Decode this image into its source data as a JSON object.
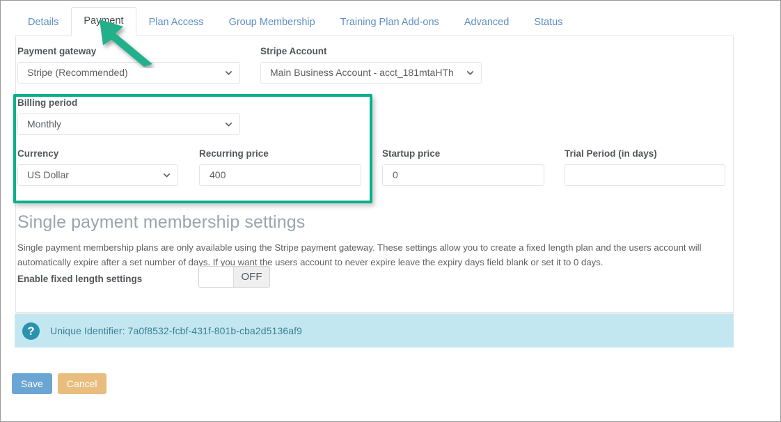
{
  "tabs": [
    {
      "label": "Details",
      "active": false
    },
    {
      "label": "Payment",
      "active": true
    },
    {
      "label": "Plan Access",
      "active": false
    },
    {
      "label": "Group Membership",
      "active": false
    },
    {
      "label": "Training Plan Add-ons",
      "active": false
    },
    {
      "label": "Advanced",
      "active": false
    },
    {
      "label": "Status",
      "active": false
    }
  ],
  "form": {
    "payment_gateway": {
      "label": "Payment gateway",
      "value": "Stripe (Recommended)"
    },
    "stripe_account": {
      "label": "Stripe Account",
      "value": "Main Business Account - acct_181mtaHTh"
    },
    "billing_period": {
      "label": "Billing period",
      "value": "Monthly"
    },
    "currency": {
      "label": "Currency",
      "value": "US Dollar"
    },
    "recurring_price": {
      "label": "Recurring price",
      "value": "400",
      "placeholder": ""
    },
    "startup_price": {
      "label": "Startup price",
      "value": "0",
      "placeholder": ""
    },
    "trial_period": {
      "label": "Trial Period (in days)",
      "value": "",
      "placeholder": ""
    }
  },
  "section": {
    "title": "Single payment membership settings",
    "description": "Single payment membership plans are only available using the Stripe payment gateway. These settings allow you to create a fixed length plan and the users account will automatically expire after a set number of days. If you want the users account to never expire leave the expiry days field blank or set it to 0 days.",
    "toggle": {
      "label": "Enable fixed length settings",
      "state": "OFF"
    }
  },
  "banner": {
    "icon": "question-mark-icon",
    "text": "Unique Identifier: 7a0f8532-fcbf-431f-801b-cba2d5136af9"
  },
  "actions": {
    "save_label": "Save",
    "cancel_label": "Cancel"
  },
  "annotations": {
    "arrow_color": "#21b08b",
    "highlight_color": "#08b08c"
  }
}
